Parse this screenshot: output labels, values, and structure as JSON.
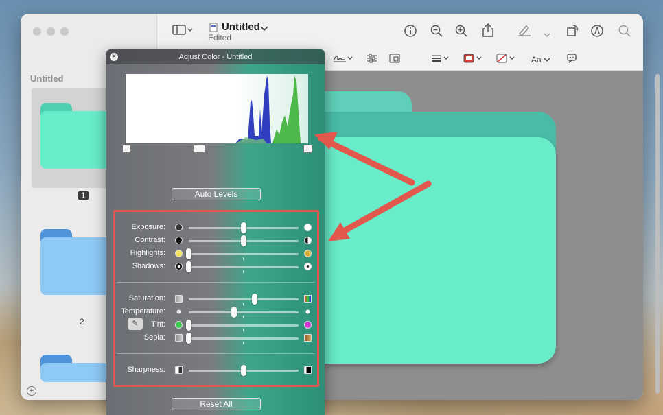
{
  "window": {
    "title": "Untitled",
    "subtitle": "Edited"
  },
  "sidebar": {
    "title": "Untitled",
    "pages": [
      {
        "label": "1",
        "color": "#69ecc9",
        "tab_color": "#4fcfb1",
        "selected": true
      },
      {
        "label": "2",
        "color": "#8fc9f5",
        "tab_color": "#4f93d9",
        "selected": false
      },
      {
        "label": "",
        "color": "#8fc9f5",
        "tab_color": "#4f93d9",
        "selected": false
      }
    ]
  },
  "toolbar": {
    "icons": [
      "sidebar-toggle-icon",
      "info-icon",
      "zoom-out-icon",
      "zoom-in-icon",
      "share-icon",
      "markup-pen-icon",
      "rotate-icon",
      "markup-toolbar-icon",
      "search-icon"
    ],
    "format_icons": [
      "signature-icon",
      "adjust-color-icon",
      "page-layout-icon",
      "line-style-icon",
      "border-color-icon",
      "fill-color-icon",
      "text-style-icon",
      "note-icon"
    ],
    "text_style_label": "Aa"
  },
  "adjust_color": {
    "title": "Adjust Color - Untitled",
    "auto_levels_label": "Auto Levels",
    "reset_all_label": "Reset All",
    "groups": [
      [
        {
          "label": "Exposure:",
          "value": 0.5,
          "icon_left": "aperture-dark-icon",
          "icon_right": "aperture-light-icon"
        },
        {
          "label": "Contrast:",
          "value": 0.5,
          "icon_left": "circle-black-icon",
          "icon_right": "circle-half-icon"
        },
        {
          "label": "Highlights:",
          "value": 0.0,
          "icon_left": "circle-yellow-icon",
          "icon_right": "circle-gold-icon"
        },
        {
          "label": "Shadows:",
          "value": 0.0,
          "icon_left": "circle-dot-black-icon",
          "icon_right": "circle-dot-white-icon"
        }
      ],
      [
        {
          "label": "Saturation:",
          "value": 0.6,
          "icon_left": "saturation-low-icon",
          "icon_right": "saturation-high-icon"
        },
        {
          "label": "Temperature:",
          "value": 0.41,
          "icon_left": "sun-cool-icon",
          "icon_right": "sun-warm-icon"
        },
        {
          "label": "Tint:",
          "value": 0.0,
          "icon_left": "circle-green-icon",
          "icon_right": "circle-magenta-icon"
        },
        {
          "label": "Sepia:",
          "value": 0.0,
          "icon_left": "sepia-low-icon",
          "icon_right": "sepia-high-icon"
        }
      ],
      [
        {
          "label": "Sharpness:",
          "value": 0.5,
          "icon_left": "sharpness-low-icon",
          "icon_right": "sharpness-high-icon"
        }
      ]
    ]
  },
  "colors": {
    "annotation_red": "#e2584d",
    "histogram_blue": "#2f3fbf",
    "histogram_green": "#4fb84a",
    "folder_green": "#69ecc9",
    "folder_blue": "#8fc9f5"
  }
}
